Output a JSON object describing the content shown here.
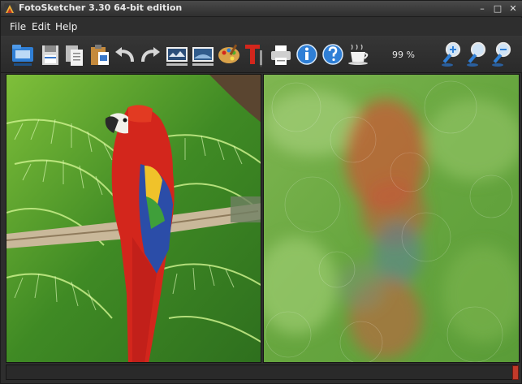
{
  "window": {
    "title": "FotoSketcher 3.30 64-bit edition",
    "controls": {
      "minimize": "–",
      "maximize": "□",
      "close": "✕"
    }
  },
  "menu": {
    "items": [
      "File",
      "Edit",
      "Help"
    ]
  },
  "toolbar": {
    "zoom_level": "99 %",
    "icons": [
      "open-folder-icon",
      "save-icon",
      "copy-icon",
      "paste-icon",
      "undo-icon",
      "redo-icon",
      "original-image-icon",
      "sketch-image-icon",
      "palette-icon",
      "text-icon",
      "print-icon",
      "info-icon",
      "help-icon",
      "coffee-icon",
      "zoom-in-icon",
      "zoom-actual-icon",
      "zoom-out-icon"
    ]
  },
  "colors": {
    "background": "#2e2e2e",
    "toolbar_blue": "#2f7fd6",
    "foliage_green": "#4f9a2c",
    "parrot_red": "#d3261c",
    "statusbar_grip": "#c23a2a"
  }
}
